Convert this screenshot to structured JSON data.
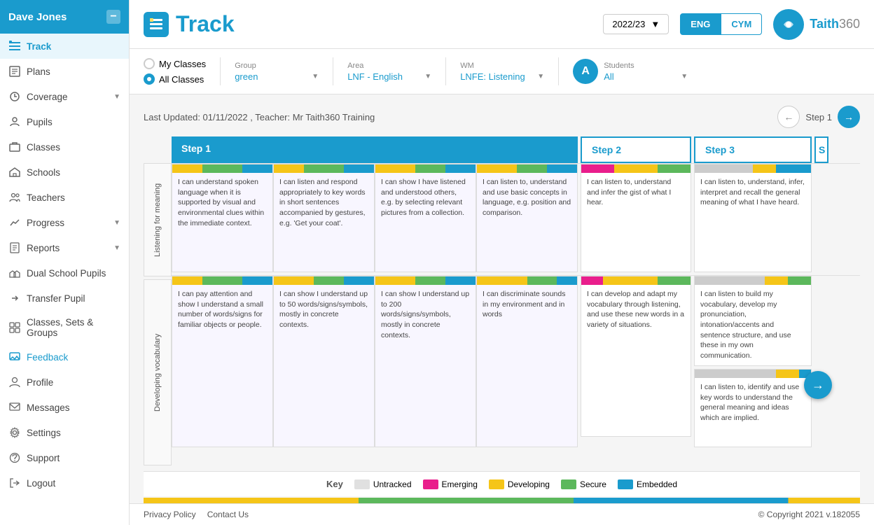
{
  "user": {
    "name": "Dave Jones"
  },
  "topbar": {
    "title": "Track",
    "year": "2022/23",
    "lang_active": "ENG",
    "lang_options": [
      "ENG",
      "CYM"
    ],
    "brand": "Taith360"
  },
  "sidebar": {
    "items": [
      {
        "id": "track",
        "label": "Track",
        "icon": "track",
        "active": true
      },
      {
        "id": "plans",
        "label": "Plans",
        "icon": "plans"
      },
      {
        "id": "coverage",
        "label": "Coverage",
        "icon": "coverage",
        "hasChevron": true
      },
      {
        "id": "pupils",
        "label": "Pupils",
        "icon": "pupils"
      },
      {
        "id": "classes",
        "label": "Classes",
        "icon": "classes"
      },
      {
        "id": "schools",
        "label": "Schools",
        "icon": "schools"
      },
      {
        "id": "teachers",
        "label": "Teachers",
        "icon": "teachers"
      },
      {
        "id": "progress",
        "label": "Progress",
        "icon": "progress",
        "hasChevron": true
      },
      {
        "id": "reports",
        "label": "Reports",
        "icon": "reports",
        "hasChevron": true
      },
      {
        "id": "dual-school",
        "label": "Dual School Pupils",
        "icon": "dual"
      },
      {
        "id": "transfer",
        "label": "Transfer Pupil",
        "icon": "transfer"
      },
      {
        "id": "classes-sets",
        "label": "Classes, Sets & Groups",
        "icon": "classsets"
      },
      {
        "id": "feedback",
        "label": "Feedback",
        "icon": "feedback",
        "active_highlight": true
      },
      {
        "id": "profile",
        "label": "Profile",
        "icon": "profile"
      },
      {
        "id": "messages",
        "label": "Messages",
        "icon": "messages"
      },
      {
        "id": "settings",
        "label": "Settings",
        "icon": "settings"
      },
      {
        "id": "support",
        "label": "Support",
        "icon": "support"
      },
      {
        "id": "logout",
        "label": "Logout",
        "icon": "logout"
      }
    ]
  },
  "filters": {
    "class_options": [
      "My Classes",
      "All Classes"
    ],
    "class_selected": "All Classes",
    "group_label": "Group",
    "group_value": "green",
    "area_label": "Area",
    "area_value": "LNF - English",
    "wm_label": "WM",
    "wm_value": "LNFE: Listening",
    "students_label": "Students",
    "students_value": "All",
    "students_avatar": "A"
  },
  "content": {
    "last_updated": "Last Updated: 01/11/2022 , Teacher: Mr Taith360 Training",
    "step_label": "Step 1",
    "steps": [
      "Step 1",
      "Step 2",
      "Step 3"
    ],
    "rows": [
      {
        "label": "Listening for meaning",
        "cards_step1": [
          {
            "text": "I can understand spoken language when it is supported by visual and environmental clues within the immediate context.",
            "bars": [
              {
                "color": "yellow",
                "pct": 40
              },
              {
                "color": "green",
                "pct": 30
              },
              {
                "color": "blue",
                "pct": 30
              }
            ]
          },
          {
            "text": "I can listen and respond appropriately to key words in short sentences accompanied by gestures, e.g. 'Get your coat'.",
            "bars": [
              {
                "color": "yellow",
                "pct": 35
              },
              {
                "color": "green",
                "pct": 40
              },
              {
                "color": "blue",
                "pct": 25
              }
            ]
          },
          {
            "text": "I can show I have listened and understood others, e.g. by selecting relevant pictures from a collection.",
            "bars": [
              {
                "color": "yellow",
                "pct": 50
              },
              {
                "color": "green",
                "pct": 20
              },
              {
                "color": "blue",
                "pct": 30
              }
            ]
          },
          {
            "text": "I can listen to, understand and use basic concepts in language, e.g. position and comparison.",
            "bars": [
              {
                "color": "yellow",
                "pct": 45
              },
              {
                "color": "green",
                "pct": 30
              },
              {
                "color": "blue",
                "pct": 25
              }
            ]
          }
        ],
        "cards_step2": [
          {
            "text": "I can listen to, understand and infer the gist of what I hear.",
            "bars": [
              {
                "color": "pink",
                "pct": 30
              },
              {
                "color": "yellow",
                "pct": 40
              },
              {
                "color": "green",
                "pct": 30
              }
            ]
          }
        ],
        "cards_step3": [
          {
            "text": "I can listen to, understand, infer, interpret and recall the general meaning of what I have heard.",
            "bars": [
              {
                "color": "gray",
                "pct": 60
              },
              {
                "color": "yellow",
                "pct": 20
              },
              {
                "color": "blue",
                "pct": 20
              }
            ]
          }
        ]
      },
      {
        "label": "Developing vocabulary",
        "cards_step1": [
          {
            "text": "I can pay attention and show I understand a small number of words/signs for familiar objects or people.",
            "bars": [
              {
                "color": "yellow",
                "pct": 40
              },
              {
                "color": "green",
                "pct": 35
              },
              {
                "color": "blue",
                "pct": 25
              }
            ]
          },
          {
            "text": "I can show I understand up to 50 words/signs/symbols, mostly in concrete contexts.",
            "bars": [
              {
                "color": "yellow",
                "pct": 50
              },
              {
                "color": "green",
                "pct": 25
              },
              {
                "color": "blue",
                "pct": 25
              }
            ]
          },
          {
            "text": "I can show I understand up to 200 words/signs/symbols, mostly in concrete contexts.",
            "bars": [
              {
                "color": "yellow",
                "pct": 45
              },
              {
                "color": "green",
                "pct": 35
              },
              {
                "color": "blue",
                "pct": 20
              }
            ]
          },
          {
            "text": "I can discriminate sounds in my environment and in words",
            "bars": [
              {
                "color": "yellow",
                "pct": 55
              },
              {
                "color": "green",
                "pct": 30
              },
              {
                "color": "blue",
                "pct": 15
              }
            ]
          }
        ],
        "cards_step2": [
          {
            "text": "I can develop and adapt my vocabulary through listening, and use these new words in a variety of situations.",
            "bars": [
              {
                "color": "pink",
                "pct": 25
              },
              {
                "color": "yellow",
                "pct": 45
              },
              {
                "color": "green",
                "pct": 30
              }
            ]
          }
        ],
        "cards_step3": [
          {
            "text": "I can listen to build my vocabulary, develop my pronunciation, intonation/accents and sentence structure, and use these in my own communication.",
            "bars": [
              {
                "color": "gray",
                "pct": 70
              },
              {
                "color": "yellow",
                "pct": 20
              },
              {
                "color": "green",
                "pct": 10
              }
            ]
          },
          {
            "text": "I can listen to, identify and use key words to understand the general meaning and ideas which are implied.",
            "bars": [
              {
                "color": "gray",
                "pct": 80
              },
              {
                "color": "yellow",
                "pct": 10
              },
              {
                "color": "blue",
                "pct": 10
              }
            ]
          }
        ]
      }
    ]
  },
  "key": {
    "label": "Key",
    "items": [
      {
        "color": "#e0e0e0",
        "label": "Untracked"
      },
      {
        "color": "#e91e8c",
        "label": "Emerging"
      },
      {
        "color": "#f5c518",
        "label": "Developing"
      },
      {
        "color": "#5cb85c",
        "label": "Secure"
      },
      {
        "color": "#1a9bcd",
        "label": "Embedded"
      }
    ]
  },
  "footer": {
    "privacy": "Privacy Policy",
    "contact": "Contact Us",
    "copyright": "© Copyright 2021 v.182055"
  }
}
